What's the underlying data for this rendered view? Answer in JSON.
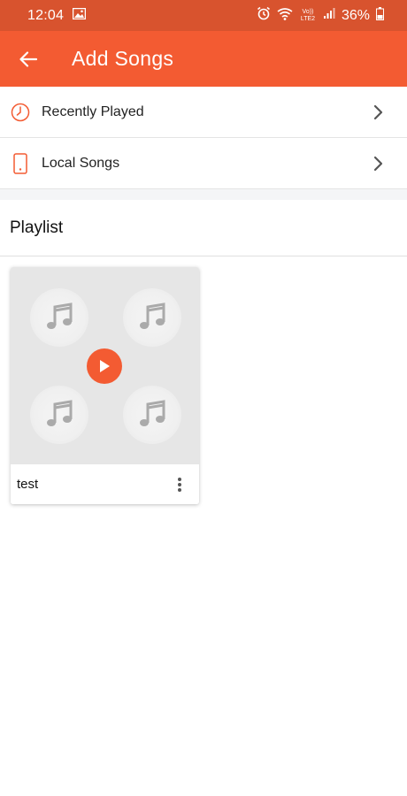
{
  "status_bar": {
    "time": "12:04",
    "network_label": "Vo)) LTE2",
    "battery": "36%"
  },
  "app_bar": {
    "title": "Add Songs",
    "accent_color": "#f35b32"
  },
  "menu": [
    {
      "label": "Recently Played",
      "icon": "clock-icon"
    },
    {
      "label": "Local Songs",
      "icon": "phone-icon"
    }
  ],
  "playlist_section": {
    "title": "Playlist",
    "items": [
      {
        "name": "test"
      }
    ]
  }
}
